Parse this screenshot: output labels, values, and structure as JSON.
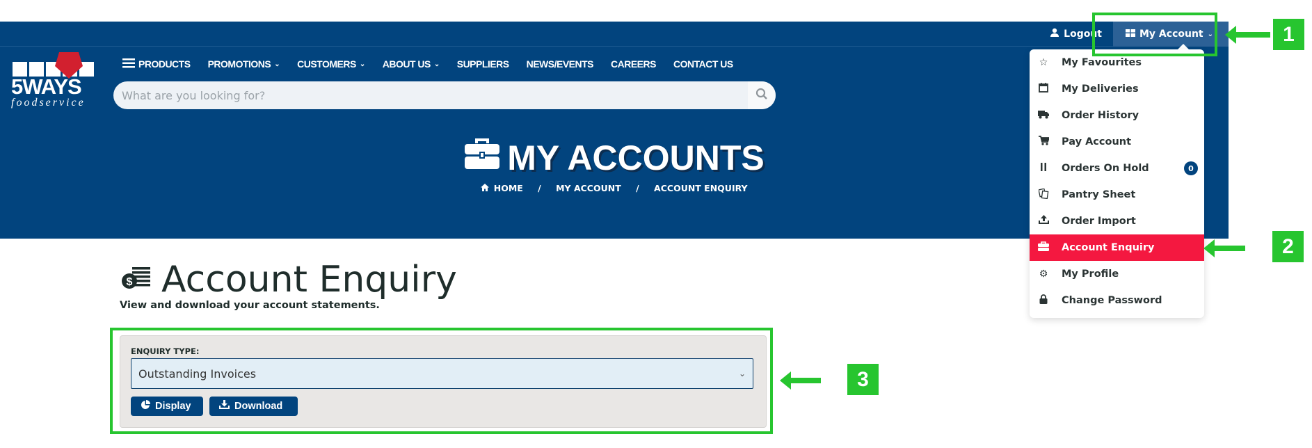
{
  "topbar": {
    "logout_label": "Logout",
    "my_account_label": "My Account"
  },
  "logo": {
    "brand": "5WAYS",
    "tagline": "foodservice"
  },
  "nav": {
    "items": [
      {
        "label": "PRODUCTS",
        "has_dropdown": false,
        "icon": "hamburger-icon"
      },
      {
        "label": "PROMOTIONS",
        "has_dropdown": true
      },
      {
        "label": "CUSTOMERS",
        "has_dropdown": true
      },
      {
        "label": "ABOUT US",
        "has_dropdown": true
      },
      {
        "label": "SUPPLIERS",
        "has_dropdown": false
      },
      {
        "label": "NEWS/EVENTS",
        "has_dropdown": false
      },
      {
        "label": "CAREERS",
        "has_dropdown": false
      },
      {
        "label": "CONTACT US",
        "has_dropdown": false
      }
    ]
  },
  "search": {
    "placeholder": "What are you looking for?",
    "value": ""
  },
  "hero": {
    "title": "MY ACCOUNTS",
    "icon": "briefcase-icon"
  },
  "breadcrumb": {
    "items": [
      "HOME",
      "MY ACCOUNT",
      "ACCOUNT ENQUIRY"
    ],
    "separator": "/"
  },
  "account_menu": {
    "items": [
      {
        "label": "My Favourites",
        "icon": "star-icon"
      },
      {
        "label": "My Deliveries",
        "icon": "calendar-icon"
      },
      {
        "label": "Order History",
        "icon": "truck-icon"
      },
      {
        "label": "Pay Account",
        "icon": "cart-icon"
      },
      {
        "label": "Orders On Hold",
        "icon": "pause-icon",
        "badge": "0"
      },
      {
        "label": "Pantry Sheet",
        "icon": "copy-icon"
      },
      {
        "label": "Order Import",
        "icon": "upload-icon"
      },
      {
        "label": "Account Enquiry",
        "icon": "briefcase-icon",
        "active": true
      },
      {
        "label": "My Profile",
        "icon": "gear-icon"
      },
      {
        "label": "Change Password",
        "icon": "lock-icon"
      }
    ],
    "active_color": "#f41840"
  },
  "main": {
    "heading": "Account Enquiry",
    "subheading": "View and download your account statements.",
    "enquiry_label": "ENQUIRY TYPE:",
    "enquiry_selected": "Outstanding Invoices",
    "display_label": "Display",
    "download_label": "Download"
  },
  "annotations": {
    "labels": [
      "1",
      "2",
      "3"
    ],
    "color": "#27c52f"
  },
  "colors": {
    "brand_blue": "#02447e",
    "accent_red": "#f41840",
    "annotation_green": "#27c52f"
  }
}
